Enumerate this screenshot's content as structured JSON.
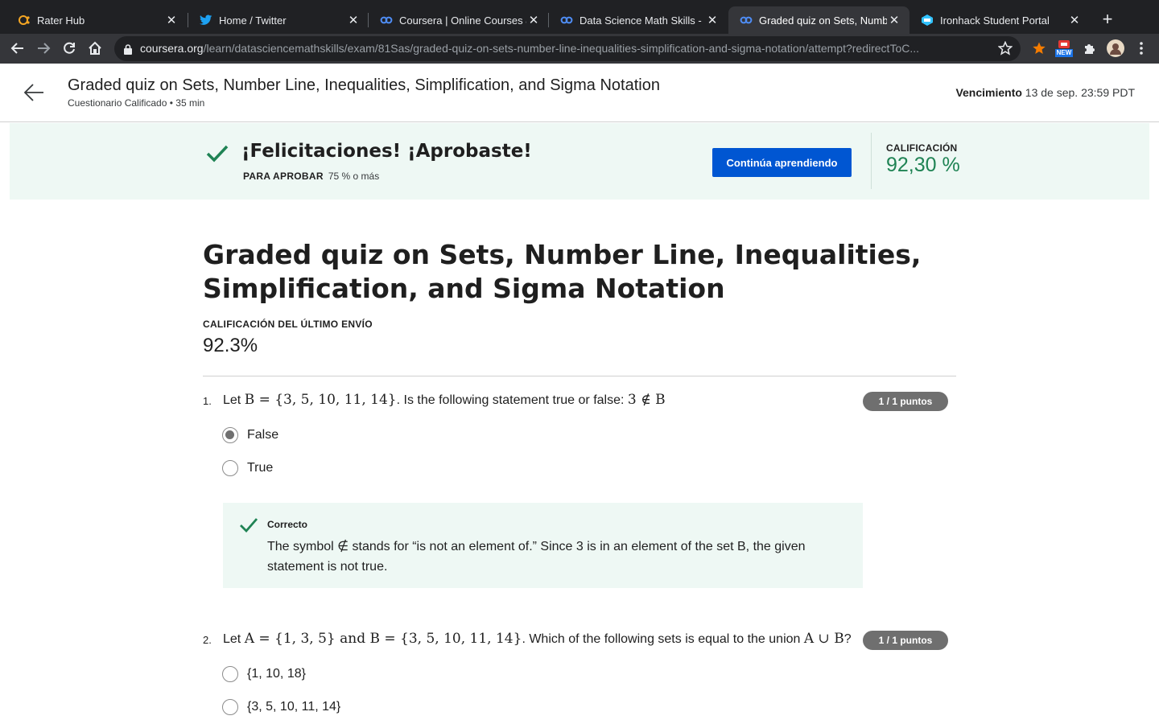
{
  "browser": {
    "tabs": [
      {
        "title": "Rater Hub",
        "icon": "raterhub-icon",
        "active": false
      },
      {
        "title": "Home / Twitter",
        "icon": "twitter-icon",
        "active": false
      },
      {
        "title": "Coursera | Online Courses &",
        "icon": "coursera-icon",
        "active": false
      },
      {
        "title": "Data Science Math Skills - Ir",
        "icon": "coursera-icon",
        "active": false
      },
      {
        "title": "Graded quiz on Sets, Numbe",
        "icon": "coursera-icon",
        "active": true
      },
      {
        "title": "Ironhack Student Portal",
        "icon": "ironhack-icon",
        "active": false
      }
    ],
    "url_domain": "coursera.org",
    "url_path": "/learn/datasciencemathskills/exam/81Sas/graded-quiz-on-sets-number-line-inequalities-simplification-and-sigma-notation/attempt?redirectToC...",
    "new_badge": "NEW"
  },
  "header": {
    "title": "Graded quiz on Sets, Number Line, Inequalities, Simplification, and Sigma Notation",
    "subtitle": "Cuestionario Calificado • 35 min",
    "due_label": "Vencimiento",
    "due_value": "13 de sep. 23:59 PDT"
  },
  "banner": {
    "title": "¡Felicitaciones! ¡Aprobaste!",
    "pass_label": "PARA APROBAR",
    "pass_value": "75 % o más",
    "continue_label": "Continúa aprendiendo",
    "grade_label": "CALIFICACIÓN",
    "grade_value": "92,30 %"
  },
  "main": {
    "title": "Graded quiz on Sets, Number Line, Inequalities, Simplification, and Sigma Notation",
    "last_label": "CALIFICACIÓN DEL ÚLTIMO ENVÍO",
    "last_value": "92.3%"
  },
  "questions": [
    {
      "number": "1.",
      "prefix": "Let ",
      "math1": "B = {3, 5, 10, 11, 14}",
      "middle": ". Is the following statement true or false: ",
      "math2": "3 ∉ B",
      "points": "1 / 1 puntos",
      "options": [
        "False",
        "True"
      ],
      "selected": 0,
      "feedback": {
        "title": "Correcto",
        "text": "The symbol ∉ stands for “is not an element of.” Since 3 is in an element of the set B, the given statement is not true."
      }
    },
    {
      "number": "2.",
      "prefix": "Let ",
      "math1": "A = {1, 3, 5}",
      "middle": " and ",
      "math2": "B = {3, 5, 10, 11, 14}",
      "suffix": ". Which of the following sets is equal to the union ",
      "math3": "A ∪ B",
      "end": "?",
      "points": "1 / 1 puntos",
      "options": [
        "{1, 10, 18}",
        "{3, 5, 10, 11, 14}"
      ]
    }
  ],
  "colors": {
    "accent": "#0056d2",
    "success": "#1f8354",
    "banner_bg": "#eef8f4"
  }
}
